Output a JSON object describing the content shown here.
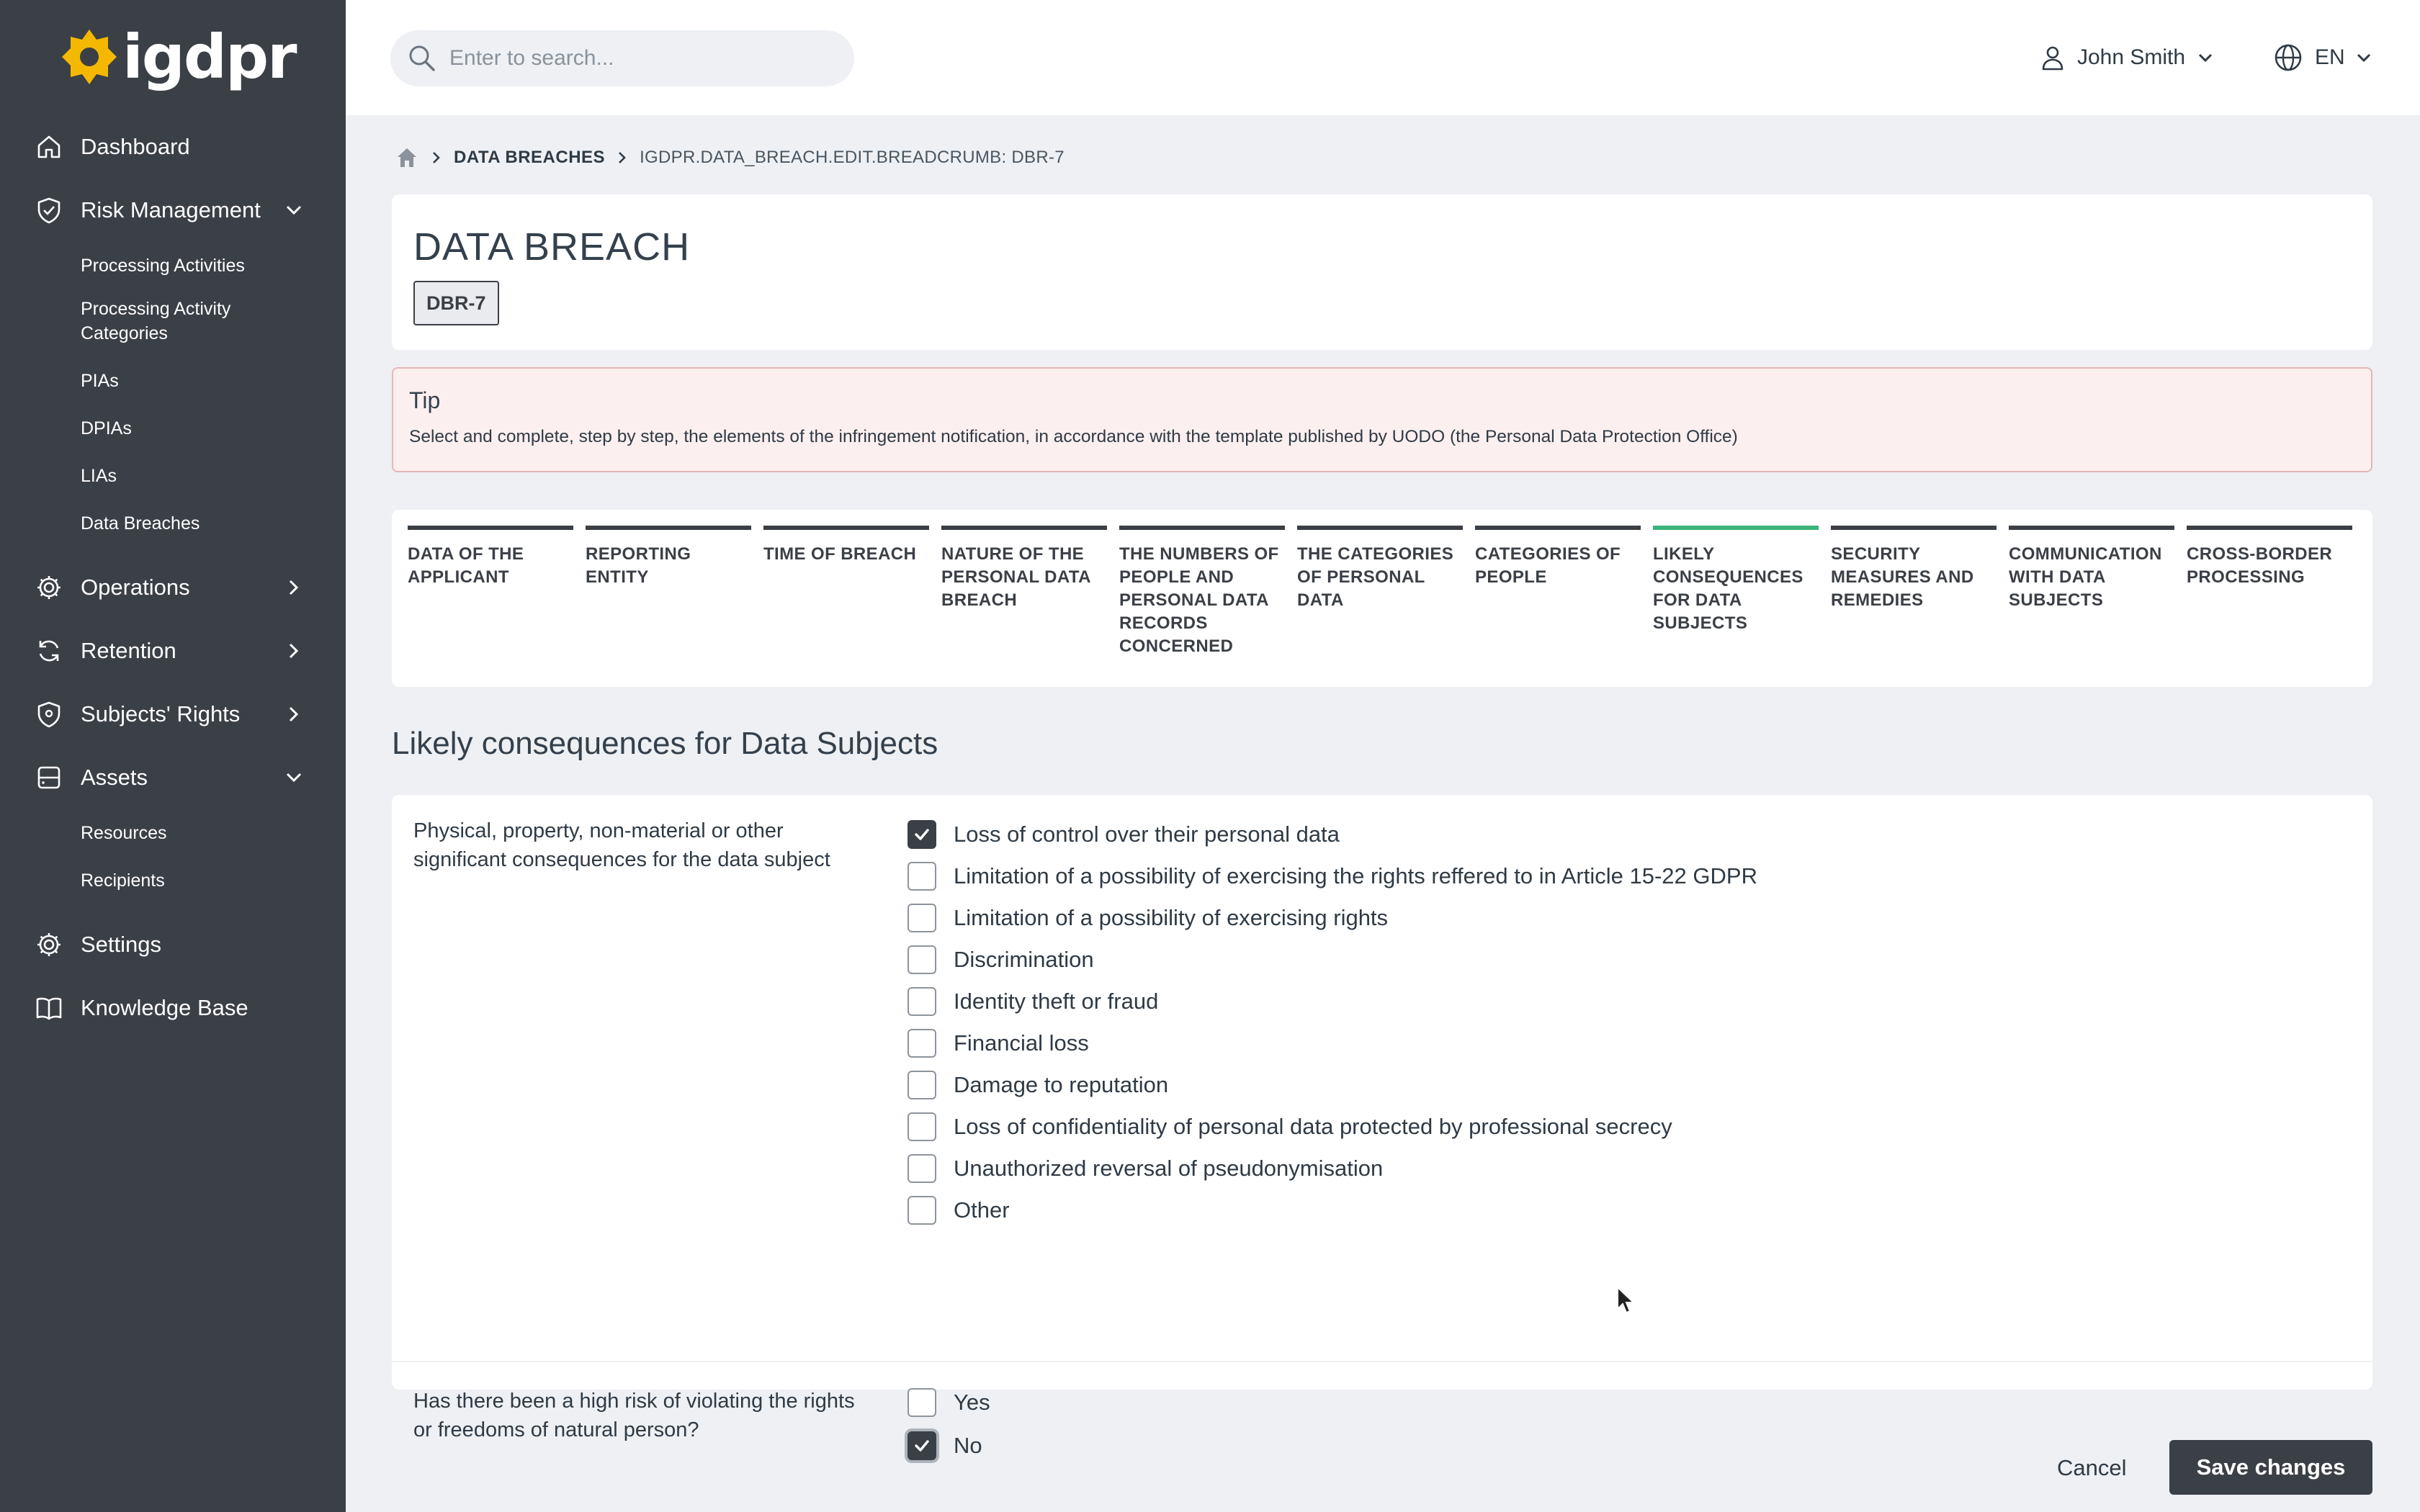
{
  "app": {
    "logo_text": "igdpr",
    "brand_color": "#f5b800",
    "accent_green": "#3bb37a",
    "dark": "#3b3f46"
  },
  "sidebar": {
    "items": [
      {
        "label": "Dashboard",
        "icon": "home-icon"
      },
      {
        "label": "Risk Management",
        "icon": "shield-check-icon",
        "expanded": true,
        "children": [
          "Processing Activities",
          "Processing Activity Categories",
          "PIAs",
          "DPIAs",
          "LIAs",
          "Data Breaches"
        ]
      },
      {
        "label": "Operations",
        "icon": "gear-icon",
        "expanded": false
      },
      {
        "label": "Retention",
        "icon": "refresh-icon",
        "expanded": false
      },
      {
        "label": "Subjects' Rights",
        "icon": "shield-icon",
        "expanded": false
      },
      {
        "label": "Assets",
        "icon": "database-icon",
        "expanded": true,
        "children": [
          "Resources",
          "Recipients"
        ]
      },
      {
        "label": "Settings",
        "icon": "gear-icon"
      },
      {
        "label": "Knowledge Base",
        "icon": "book-icon"
      }
    ]
  },
  "topbar": {
    "search_placeholder": "Enter to search...",
    "user_name": "John Smith",
    "language": "EN"
  },
  "breadcrumb": {
    "section": "DATA BREACHES",
    "current": "IGDPR.DATA_BREACH.EDIT.BREADCRUMB: DBR-7"
  },
  "page": {
    "title": "DATA BREACH",
    "id_badge": "DBR-7"
  },
  "tip": {
    "title": "Tip",
    "text": "Select and complete, step by step, the elements of the infringement notification, in accordance with the template published by UODO (the Personal Data Protection Office)"
  },
  "steps": [
    {
      "label": "DATA OF THE APPLICANT",
      "active": false
    },
    {
      "label": "REPORTING ENTITY",
      "active": false
    },
    {
      "label": "TIME OF BREACH",
      "active": false
    },
    {
      "label": "NATURE OF THE PERSONAL DATA BREACH",
      "active": false
    },
    {
      "label": "THE NUMBERS OF PEOPLE AND PERSONAL DATA RECORDS CONCERNED",
      "active": false
    },
    {
      "label": "THE CATEGORIES OF PERSONAL DATA",
      "active": false
    },
    {
      "label": "CATEGORIES OF PEOPLE",
      "active": false
    },
    {
      "label": "LIKELY CONSEQUENCES FOR DATA SUBJECTS",
      "active": true
    },
    {
      "label": "SECURITY MEASURES AND REMEDIES",
      "active": false
    },
    {
      "label": "COMMUNICATION WITH DATA SUBJECTS",
      "active": false
    },
    {
      "label": "CROSS-BORDER PROCESSING",
      "active": false
    }
  ],
  "form": {
    "section_title": "Likely consequences for Data Subjects",
    "q1": {
      "label": "Physical, property, non-material or other significant consequences for the data subject",
      "options": [
        {
          "label": "Loss of control over their personal data",
          "checked": true
        },
        {
          "label": "Limitation of a possibility of exercising the rights reffered to in Article 15-22 GDPR",
          "checked": false
        },
        {
          "label": "Limitation of a possibility of exercising rights",
          "checked": false
        },
        {
          "label": "Discrimination",
          "checked": false
        },
        {
          "label": "Identity theft or fraud",
          "checked": false
        },
        {
          "label": "Financial loss",
          "checked": false
        },
        {
          "label": "Damage to reputation",
          "checked": false
        },
        {
          "label": "Loss of confidentiality of personal data protected by professional secrecy",
          "checked": false
        },
        {
          "label": "Unauthorized reversal of pseudonymisation",
          "checked": false
        },
        {
          "label": "Other",
          "checked": false
        }
      ]
    },
    "q2": {
      "label": "Has there been a high risk of violating the rights or freedoms of natural person?",
      "options": [
        {
          "label": "Yes",
          "checked": false
        },
        {
          "label": "No",
          "checked": true
        }
      ]
    }
  },
  "actions": {
    "cancel": "Cancel",
    "save": "Save changes"
  }
}
